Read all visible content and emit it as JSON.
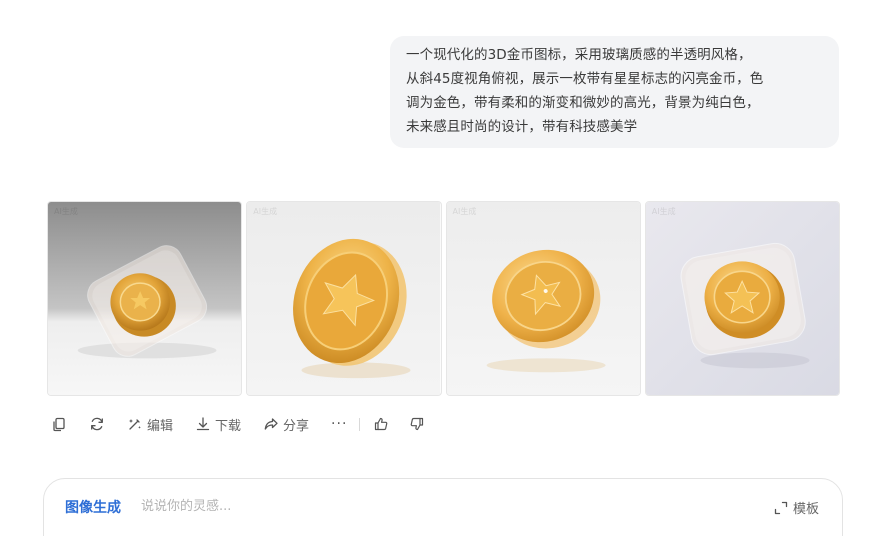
{
  "prompt": {
    "lines": [
      "一个现代化的3D金币图标，采用玻璃质感的半透明风格，",
      "从斜45度视角俯视，展示一枚带有星星标志的闪亮金币，色",
      "调为金色，带有柔和的渐变和微妙的高光，背景为纯白色，",
      "未来感且时尚的设计，带有科技感美学"
    ]
  },
  "images": [
    {
      "icon": "glass-coin-on-gray-image"
    },
    {
      "icon": "gold-star-coin-side-image"
    },
    {
      "icon": "gold-star-coin-tilted-image"
    },
    {
      "icon": "gold-coin-glass-square-image"
    }
  ],
  "actions": {
    "copy_icon": "copy-icon",
    "regenerate_icon": "refresh-icon",
    "edit_label": "编辑",
    "download_label": "下载",
    "share_label": "分享",
    "more_label": "···"
  },
  "composer": {
    "mode_label": "图像生成",
    "placeholder": "说说你的灵感...",
    "template_label": "模板"
  },
  "colors": {
    "accent": "#2f6fd6",
    "bubble_bg": "#f3f4f6",
    "gold": "#e8ad3c"
  }
}
